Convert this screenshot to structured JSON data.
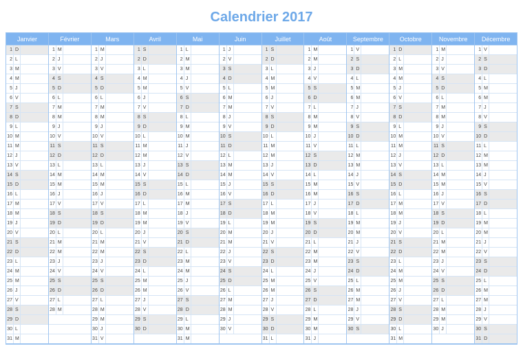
{
  "title": "Calendrier 2017",
  "dow_labels": [
    "L",
    "M",
    "M",
    "J",
    "V",
    "S",
    "D"
  ],
  "months": [
    {
      "name": "Janvier",
      "days": 31,
      "start": 6
    },
    {
      "name": "Février",
      "days": 28,
      "start": 2
    },
    {
      "name": "Mars",
      "days": 31,
      "start": 2
    },
    {
      "name": "Avril",
      "days": 30,
      "start": 5
    },
    {
      "name": "Mai",
      "days": 31,
      "start": 0
    },
    {
      "name": "Juin",
      "days": 30,
      "start": 3
    },
    {
      "name": "Juillet",
      "days": 31,
      "start": 5
    },
    {
      "name": "Août",
      "days": 31,
      "start": 1
    },
    {
      "name": "Septembre",
      "days": 30,
      "start": 4
    },
    {
      "name": "Octobre",
      "days": 31,
      "start": 6
    },
    {
      "name": "Novembre",
      "days": 30,
      "start": 2
    },
    {
      "name": "Décembre",
      "days": 31,
      "start": 4
    }
  ]
}
